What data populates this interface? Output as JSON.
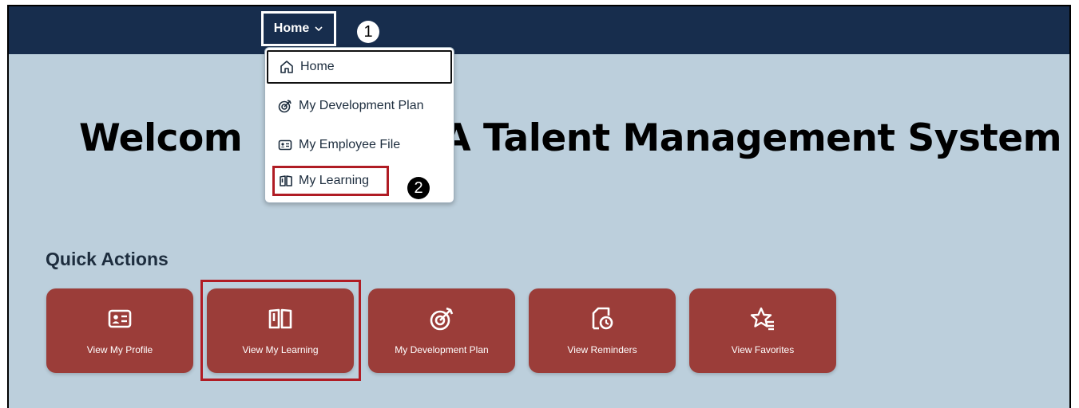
{
  "header": {
    "menu_label": "Home",
    "callout_1": "1",
    "callout_2": "2"
  },
  "dropdown": {
    "items": [
      {
        "label": "Home",
        "icon": "home-icon"
      },
      {
        "label": "My Development Plan",
        "icon": "target-icon"
      },
      {
        "label": "My Employee File",
        "icon": "id-card-icon"
      },
      {
        "label": "My Learning",
        "icon": "open-book-icon"
      }
    ]
  },
  "main": {
    "welcome_left": "Welcom",
    "welcome_right": "A Talent Management System",
    "quick_actions_title": "Quick Actions",
    "tiles": [
      {
        "label": "View My Profile",
        "icon": "id-card-icon"
      },
      {
        "label": "View My Learning",
        "icon": "open-book-icon"
      },
      {
        "label": "My Development Plan",
        "icon": "target-icon"
      },
      {
        "label": "View Reminders",
        "icon": "reminder-clock-icon"
      },
      {
        "label": "View Favorites",
        "icon": "favorite-star-icon"
      }
    ]
  },
  "colors": {
    "topbar": "#172d4d",
    "page_bg": "#bccfdc",
    "tile_bg": "#9b3d39",
    "highlight": "#b01c24"
  }
}
